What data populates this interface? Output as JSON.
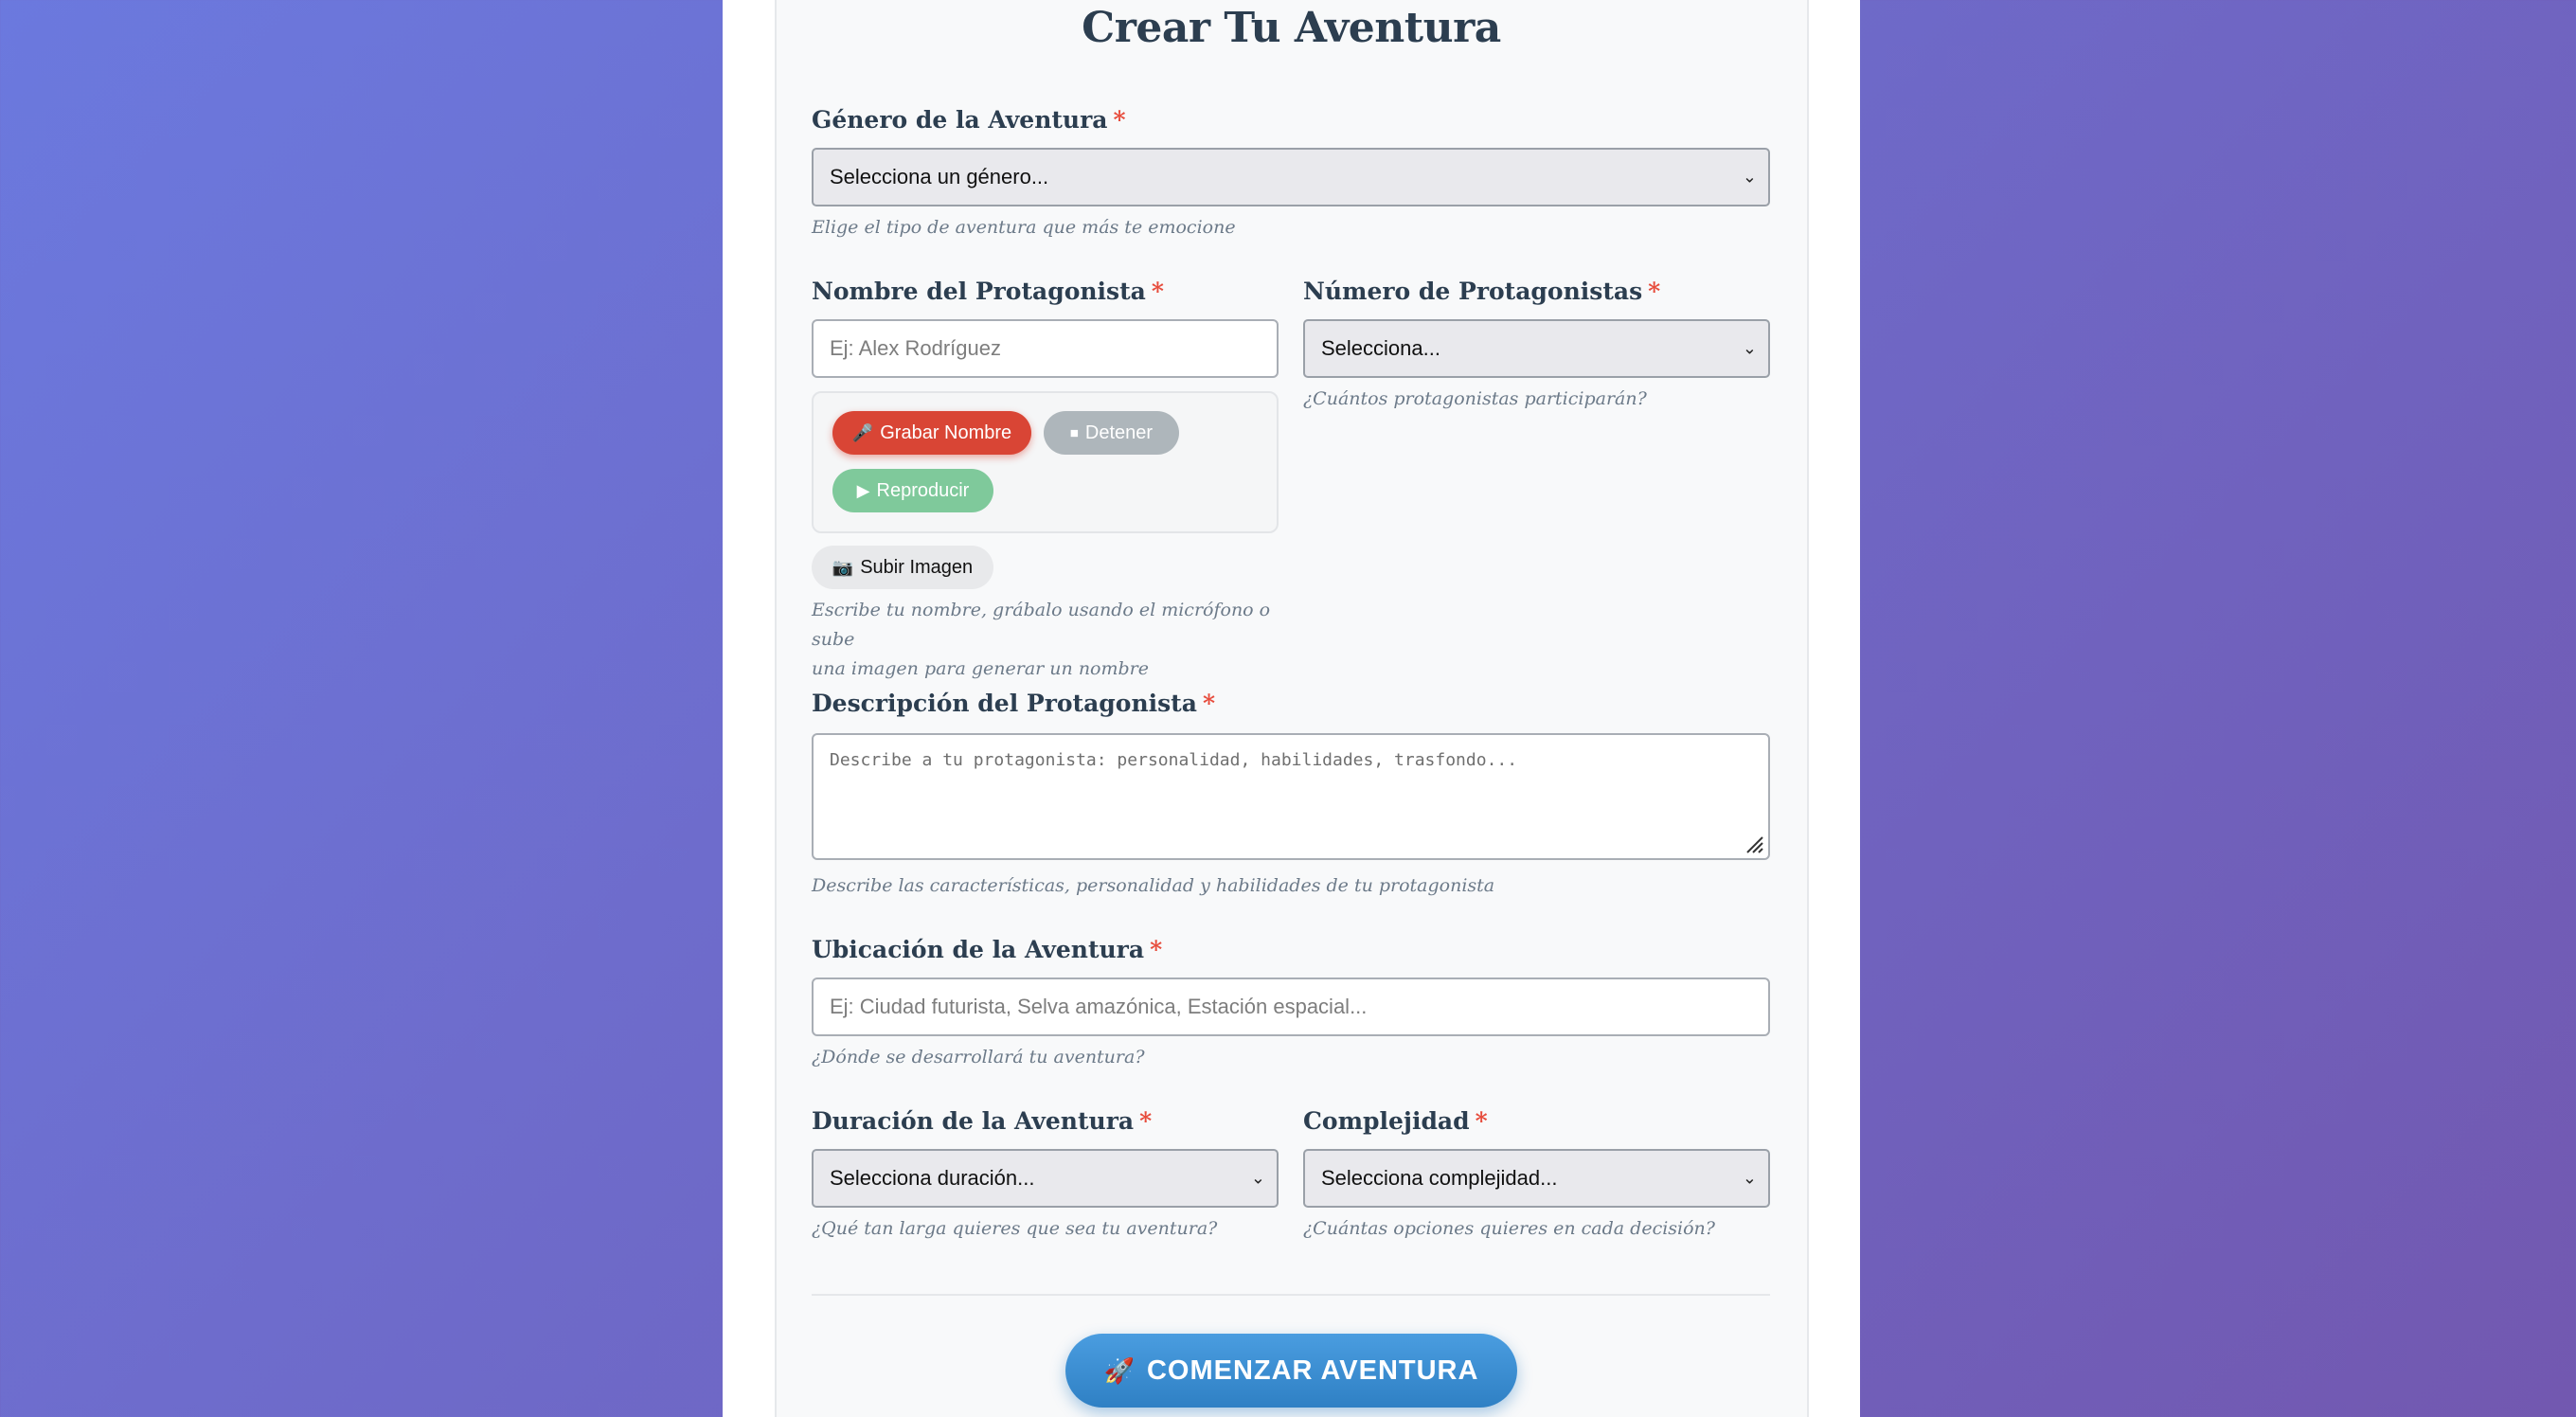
{
  "form": {
    "title": "Crear Tu Aventura",
    "required_mark": "*",
    "genre": {
      "label": "Género de la Aventura",
      "selected": "Selecciona un género...",
      "help": "Elige el tipo de aventura que más te emocione"
    },
    "name": {
      "label": "Nombre del Protagonista",
      "placeholder": "Ej: Alex Rodríguez",
      "record_label": "Grabar Nombre",
      "stop_label": "Detener",
      "play_label": "Reproducir",
      "upload_label": "Subir Imagen",
      "help_line1": "Escribe tu nombre, grábalo usando el micrófono o sube",
      "help_line2": "una imagen para generar un nombre"
    },
    "count": {
      "label": "Número de Protagonistas",
      "selected": "Selecciona...",
      "help": "¿Cuántos protagonistas participarán?"
    },
    "description": {
      "label": "Descripción del Protagonista",
      "placeholder": "Describe a tu protagonista: personalidad, habilidades, trasfondo...",
      "help": "Describe las características, personalidad y habilidades de tu protagonista"
    },
    "location": {
      "label": "Ubicación de la Aventura",
      "placeholder": "Ej: Ciudad futurista, Selva amazónica, Estación espacial...",
      "help": "¿Dónde se desarrollará tu aventura?"
    },
    "duration": {
      "label": "Duración de la Aventura",
      "selected": "Selecciona duración...",
      "help": "¿Qué tan larga quieres que sea tu aventura?"
    },
    "complexity": {
      "label": "Complejidad",
      "selected": "Selecciona complejidad...",
      "help": "¿Cuántas opciones quieres en cada decisión?"
    },
    "submit_label": "COMENZAR AVENTURA"
  },
  "icons": {
    "record": "microphone-icon",
    "stop": "stop-icon",
    "play": "play-icon",
    "upload": "camera-icon",
    "submit": "rocket-icon",
    "dropdown": "chevron-down-icon"
  },
  "colors": {
    "background_start": "#6b79de",
    "background_end": "#7258b0",
    "heading": "#2c3e50",
    "required": "#e74c3c",
    "record": "#d94535",
    "stop": "#aeb6bb",
    "play": "#7fc99b",
    "primary": "#3d8fd0"
  }
}
